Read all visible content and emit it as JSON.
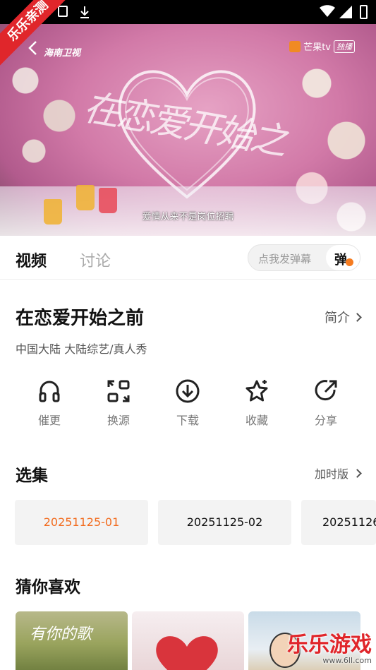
{
  "watermark_ribbon": "乐乐亲测",
  "video": {
    "channel_logo": "海南卫视",
    "platform_logo": "芒果tv",
    "exclusive_badge": "独播",
    "art_title": "在恋爱开始之",
    "subtitle": "爱情从来不是岗位招聘"
  },
  "tabs": [
    {
      "label": "视频"
    },
    {
      "label": "讨论"
    }
  ],
  "danmu": {
    "placeholder": "点我发弹幕",
    "button_char": "弹"
  },
  "show": {
    "title": "在恋爱开始之前",
    "intro_label": "简介",
    "meta": "中国大陆  大陆综艺/真人秀"
  },
  "actions": [
    {
      "label": "催更",
      "icon": "headphones-icon"
    },
    {
      "label": "换源",
      "icon": "switch-source-icon"
    },
    {
      "label": "下载",
      "icon": "download-icon"
    },
    {
      "label": "收藏",
      "icon": "star-icon"
    },
    {
      "label": "分享",
      "icon": "share-icon"
    }
  ],
  "episodes": {
    "title": "选集",
    "more_label": "加时版",
    "items": [
      {
        "label": "20251125-01",
        "active": true
      },
      {
        "label": "20251125-02",
        "active": false
      },
      {
        "label": "20251126",
        "active": false
      }
    ]
  },
  "recommend": {
    "title": "猜你喜欢",
    "thumb1_art": "有你的歌"
  },
  "watermark": {
    "text": "乐乐游戏",
    "url": "www.6ll.com"
  },
  "colors": {
    "accent": "#f26b1d",
    "ribbon": "#e0262b"
  }
}
